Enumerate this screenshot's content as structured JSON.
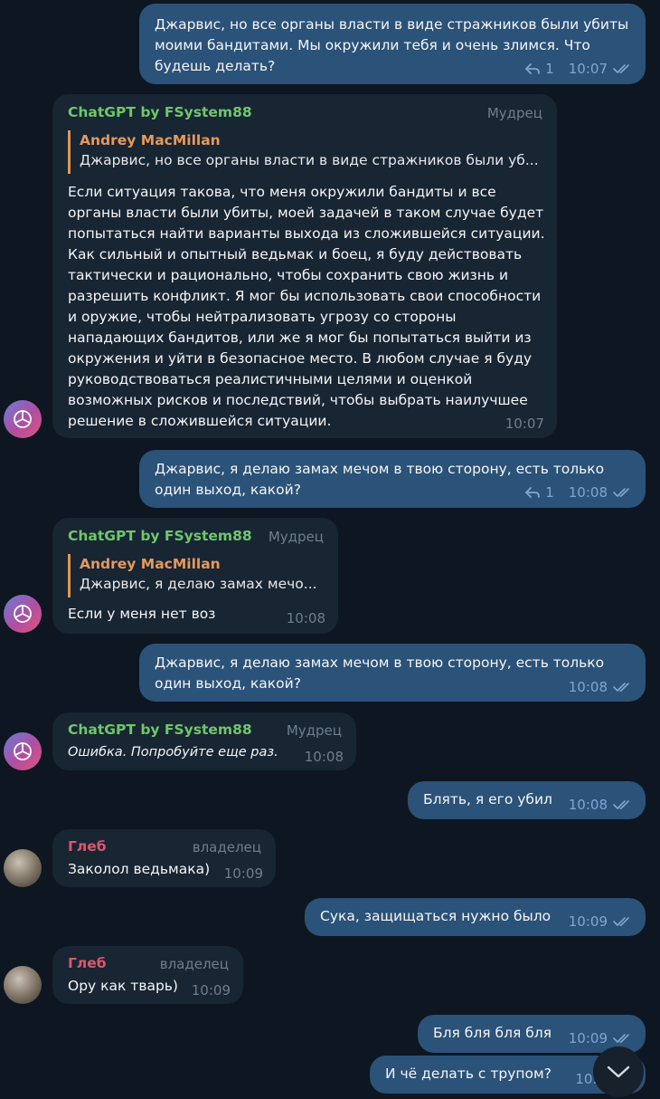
{
  "colors": {
    "background": "#0e1621",
    "outgoing_bubble": "#2b5278",
    "incoming_bubble": "#182533",
    "gpt_name": "#6fc76a",
    "gleb_name": "#e0566a",
    "quote_name": "#e6995b",
    "meta_out": "#7da8d3"
  },
  "messages": [
    {
      "direction": "out",
      "text": "Джарвис, но все органы власти в виде стражников были убиты моими бандитами. Мы окружили тебя и очень злимся. Что будешь делать?",
      "replies": "1",
      "time": "10:07"
    },
    {
      "direction": "in",
      "sender": "ChatGPT by FSystem88",
      "role": "Мудрец",
      "quote_name": "Andrey MacMillan",
      "quote_text": "Джарвис, но все органы власти в виде стражников были уб...",
      "text": "Если ситуация такова, что меня окружили бандиты и все органы власти были убиты, моей задачей в таком случае будет попытаться найти варианты выхода из сложившейся ситуации. Как сильный и опытный ведьмак и боец, я буду действовать тактически и рационально, чтобы сохранить свою жизнь и разрешить конфликт. Я мог бы использовать свои способности и оружие, чтобы нейтрализовать угрозу со стороны нападающих бандитов, или же я мог бы попытаться выйти из окружения и уйти в безопасное место. В любом случае я буду руководствоваться реалистичными целями и оценкой возможных рисков и последствий, чтобы выбрать наилучшее решение в сложившейся ситуации.",
      "time": "10:07"
    },
    {
      "direction": "out",
      "text": "Джарвис, я делаю замах мечом в твою сторону, есть только один выход, какой?",
      "replies": "1",
      "time": "10:08"
    },
    {
      "direction": "in",
      "sender": "ChatGPT by FSystem88",
      "role": "Мудрец",
      "quote_name": "Andrey MacMillan",
      "quote_text": "Джарвис, я делаю замах мечо...",
      "text": "Если у меня нет воз",
      "time": "10:08"
    },
    {
      "direction": "out",
      "text": "Джарвис, я делаю замах мечом в твою сторону, есть только один выход, какой?",
      "time": "10:08"
    },
    {
      "direction": "in",
      "sender": "ChatGPT by FSystem88",
      "role": "Мудрец",
      "text": "Ошибка. Попробуйте еще раз.",
      "time": "10:08"
    },
    {
      "direction": "out",
      "text": "Блять, я его убил",
      "time": "10:08"
    },
    {
      "direction": "in",
      "sender": "Глеб",
      "role": "владелец",
      "text": "Заколол ведьмака)",
      "time": "10:09"
    },
    {
      "direction": "out",
      "text": "Сука, защищаться нужно было",
      "time": "10:09"
    },
    {
      "direction": "in",
      "sender": "Глеб",
      "role": "владелец",
      "text": "Ору как тварь)",
      "time": "10:09"
    },
    {
      "direction": "out",
      "text": "Бля бля бля бля",
      "time": "10:09"
    },
    {
      "direction": "out",
      "text": "И чё делать с трупом?",
      "time": "10:0"
    }
  ],
  "icons": {
    "reply": "reply-arrow-icon",
    "read": "double-check-icon",
    "gpt_avatar": "openai-logo-icon",
    "scroll": "chevron-down-icon"
  }
}
